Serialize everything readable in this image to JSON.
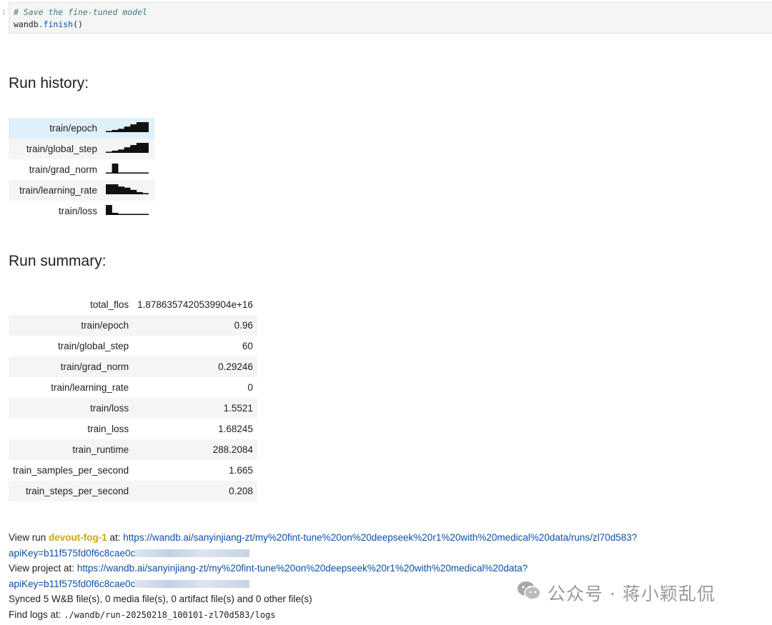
{
  "cell": {
    "prompt": ":",
    "comment": "# Save the fine-tuned model",
    "code_object": "wandb",
    "code_dot": ".",
    "code_function": "finish",
    "code_parens": "()"
  },
  "run_history": {
    "heading": "Run history:",
    "rows": [
      {
        "name": "train/epoch",
        "sparkline": [
          1,
          2,
          3,
          5,
          7,
          9,
          9
        ]
      },
      {
        "name": "train/global_step",
        "sparkline": [
          1,
          2,
          3,
          5,
          7,
          9,
          9
        ]
      },
      {
        "name": "train/grad_norm",
        "sparkline": [
          1,
          9,
          1,
          1,
          1,
          1,
          1
        ]
      },
      {
        "name": "train/learning_rate",
        "sparkline": [
          9,
          9,
          7,
          6,
          4,
          2,
          1
        ]
      },
      {
        "name": "train/loss",
        "sparkline": [
          9,
          2,
          1,
          1,
          1,
          1,
          1
        ]
      }
    ]
  },
  "run_summary": {
    "heading": "Run summary:",
    "rows": [
      {
        "name": "total_flos",
        "value": "1.8786357420539904e+16"
      },
      {
        "name": "train/epoch",
        "value": "0.96"
      },
      {
        "name": "train/global_step",
        "value": "60"
      },
      {
        "name": "train/grad_norm",
        "value": "0.29246"
      },
      {
        "name": "train/learning_rate",
        "value": "0"
      },
      {
        "name": "train/loss",
        "value": "1.5521"
      },
      {
        "name": "train_loss",
        "value": "1.68245"
      },
      {
        "name": "train_runtime",
        "value": "288.2084"
      },
      {
        "name": "train_samples_per_second",
        "value": "1.665"
      },
      {
        "name": "train_steps_per_second",
        "value": "0.208"
      }
    ]
  },
  "footer": {
    "view_run_prefix": "View run ",
    "run_name": "devout-fog-1",
    "view_run_mid": " at: ",
    "run_url": "https://wandb.ai/sanyinjiang-zt/my%20fint-tune%20on%20deepseek%20r1%20with%20medical%20data/runs/zl70d583?",
    "run_api_key": "apiKey=b11f575fd0f6c8cae0c",
    "view_project_prefix": "View project at: ",
    "project_url": "https://wandb.ai/sanyinjiang-zt/my%20fint-tune%20on%20deepseek%20r1%20with%20medical%20data?",
    "project_api_key": "apiKey=b11f575fd0f6c8cae0c",
    "synced": "Synced 5 W&B file(s), 0 media file(s), 0 artifact file(s) and 0 other file(s)",
    "logs_prefix": "Find logs at: ",
    "logs_path": "./wandb/run-20250218_100101-zl70d583/logs"
  },
  "watermark": {
    "text": "公众号 · 蒋小颖乱侃",
    "icon": "wechat-icon"
  },
  "colors": {
    "link": "#0b4fa8",
    "run_name": "#c9a800",
    "row_hover": "#dff0fa",
    "row_stripe": "#f5f5f5"
  }
}
